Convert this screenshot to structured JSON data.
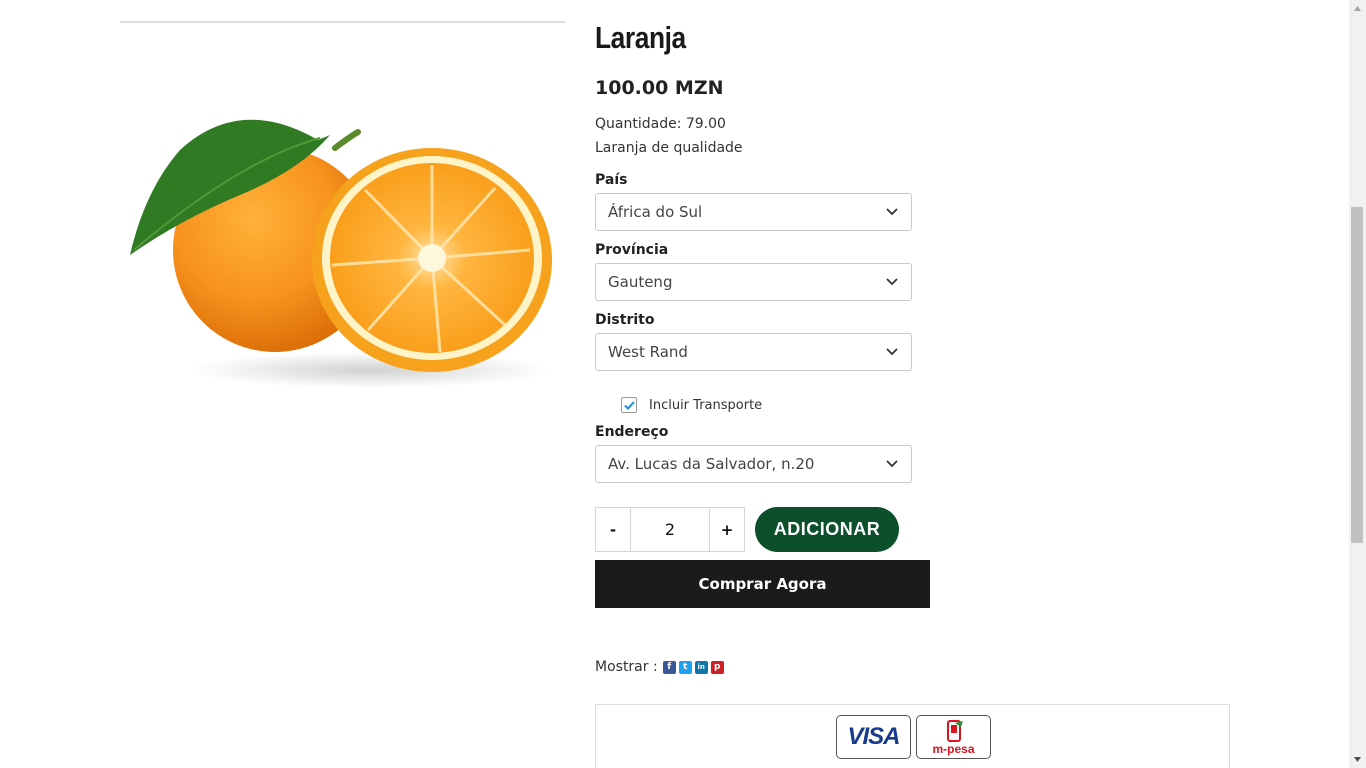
{
  "product": {
    "title": "Laranja",
    "price": "100.00 MZN",
    "quantity_text": "Quantidade: 79.00",
    "description": "Laranja de qualidade",
    "image_icon": "orange-fruit-image"
  },
  "form": {
    "country": {
      "label": "País",
      "value": "África do Sul"
    },
    "province": {
      "label": "Província",
      "value": "Gauteng"
    },
    "district": {
      "label": "Distrito",
      "value": "West Rand"
    },
    "transport": {
      "label": "Incluir Transporte",
      "checked": true
    },
    "address": {
      "label": "Endereço",
      "value": "Av. Lucas da Salvador, n.20"
    }
  },
  "cart": {
    "minus_label": "-",
    "plus_label": "+",
    "quantity": "2",
    "add_label": "ADICIONAR",
    "buy_label": "Comprar Agora"
  },
  "share": {
    "label": "Mostrar :",
    "networks": [
      {
        "icon": "facebook-icon",
        "glyph": "f",
        "color": "#3b5998"
      },
      {
        "icon": "twitter-icon",
        "glyph": "t",
        "color": "#1da1f2"
      },
      {
        "icon": "linkedin-icon",
        "glyph": "in",
        "color": "#0e76a8"
      },
      {
        "icon": "pinterest-icon",
        "glyph": "p",
        "color": "#cb2027"
      }
    ]
  },
  "payment": {
    "visa_text": "VISA",
    "mpesa_text": "m-pesa"
  },
  "colors": {
    "brand_green": "#0b4f2b",
    "buy_black": "#1b1b1b",
    "checkbox_blue": "#1a8fd6",
    "mpesa_red": "#d9151d"
  }
}
